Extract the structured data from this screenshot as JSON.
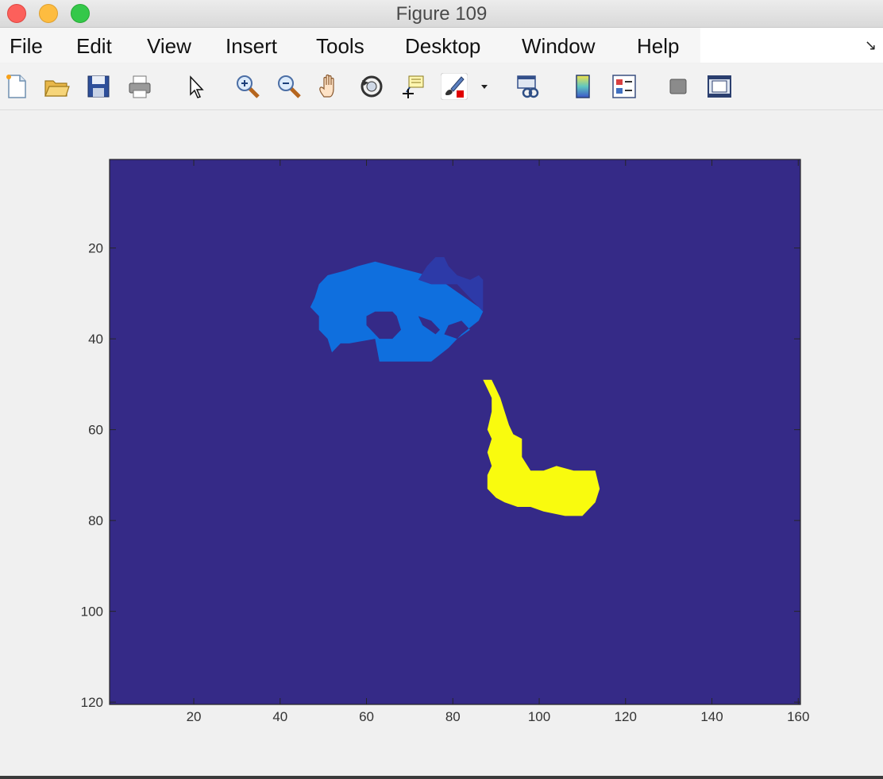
{
  "window": {
    "title": "Figure 109"
  },
  "menu": [
    "File",
    "Edit",
    "View",
    "Insert",
    "Tools",
    "Desktop",
    "Window",
    "Help"
  ],
  "menu_corner_icon": "dock-arrow-icon",
  "toolbar": [
    "new-figure-icon",
    "open-file-icon",
    "save-icon",
    "print-icon",
    "pointer-icon",
    "zoom-in-icon",
    "zoom-out-icon",
    "pan-icon",
    "rotate-3d-icon",
    "data-cursor-icon",
    "brush-icon",
    "brush-dropdown-icon",
    "link-plot-icon",
    "colorbar-icon",
    "legend-icon",
    "hide-plot-tools-icon",
    "show-plot-tools-icon"
  ],
  "chart_data": {
    "type": "heatmap",
    "xlim": [
      0.5,
      160.5
    ],
    "ylim": [
      0.5,
      120.5
    ],
    "y_reversed": true,
    "x_ticks": [
      20,
      40,
      60,
      80,
      100,
      120,
      140,
      160
    ],
    "y_ticks": [
      20,
      40,
      60,
      80,
      100,
      120
    ],
    "grid": false,
    "colors": {
      "background": "#352a87",
      "region_blue": "#0f6fde",
      "region_darkblue": "#2d3aa8",
      "region_yellow": "#f9fb0e"
    },
    "regions": [
      {
        "color_key": "region_blue",
        "outline": [
          [
            48,
            31
          ],
          [
            49,
            28
          ],
          [
            51,
            26
          ],
          [
            55,
            25
          ],
          [
            58,
            24
          ],
          [
            62,
            23
          ],
          [
            66,
            24
          ],
          [
            70,
            25
          ],
          [
            74,
            26
          ],
          [
            77,
            27
          ],
          [
            80,
            29
          ],
          [
            83,
            31
          ],
          [
            86,
            33
          ],
          [
            87,
            34
          ],
          [
            86,
            36
          ],
          [
            82,
            39
          ],
          [
            79,
            42
          ],
          [
            75,
            45
          ],
          [
            69,
            45
          ],
          [
            63,
            45
          ],
          [
            62,
            40
          ],
          [
            56,
            41
          ],
          [
            54,
            41
          ],
          [
            52,
            43
          ],
          [
            51,
            40
          ],
          [
            49,
            38
          ],
          [
            49,
            35
          ],
          [
            47,
            33
          ]
        ],
        "holes": [
          [
            [
              60,
              35
            ],
            [
              62,
              34
            ],
            [
              66,
              34
            ],
            [
              67,
              35
            ],
            [
              68,
              38
            ],
            [
              66,
              40
            ],
            [
              63,
              40
            ],
            [
              60,
              37
            ]
          ],
          [
            [
              72,
              35
            ],
            [
              75,
              36
            ],
            [
              77,
              38
            ],
            [
              76,
              39
            ],
            [
              73,
              37
            ]
          ],
          [
            [
              79,
              37
            ],
            [
              82,
              36
            ],
            [
              84,
              38
            ],
            [
              81,
              40
            ],
            [
              78,
              39
            ]
          ]
        ]
      },
      {
        "color_key": "region_darkblue",
        "outline": [
          [
            72,
            27
          ],
          [
            74,
            24
          ],
          [
            76,
            22
          ],
          [
            78,
            22
          ],
          [
            79,
            24
          ],
          [
            81,
            26
          ],
          [
            84,
            27
          ],
          [
            86,
            26
          ],
          [
            87,
            27
          ],
          [
            87,
            34
          ],
          [
            84,
            31
          ],
          [
            81,
            28
          ],
          [
            78,
            28
          ],
          [
            75,
            28
          ]
        ]
      },
      {
        "color_key": "region_yellow",
        "outline": [
          [
            87,
            49
          ],
          [
            89,
            49
          ],
          [
            90,
            51
          ],
          [
            91,
            53
          ],
          [
            92,
            56
          ],
          [
            93,
            59
          ],
          [
            94,
            61
          ],
          [
            96,
            62
          ],
          [
            96,
            66
          ],
          [
            98,
            69
          ],
          [
            101,
            69
          ],
          [
            104,
            68
          ],
          [
            108,
            69
          ],
          [
            113,
            69
          ],
          [
            114,
            73
          ],
          [
            113,
            76
          ],
          [
            110,
            79
          ],
          [
            106,
            79
          ],
          [
            101,
            78
          ],
          [
            98,
            77
          ],
          [
            95,
            77
          ],
          [
            92,
            76
          ],
          [
            90,
            75
          ],
          [
            88,
            73
          ],
          [
            88,
            70
          ],
          [
            89,
            68
          ],
          [
            88,
            65
          ],
          [
            89,
            62
          ],
          [
            88,
            60
          ],
          [
            89,
            56
          ],
          [
            89,
            53
          ],
          [
            88,
            51
          ]
        ]
      }
    ]
  }
}
